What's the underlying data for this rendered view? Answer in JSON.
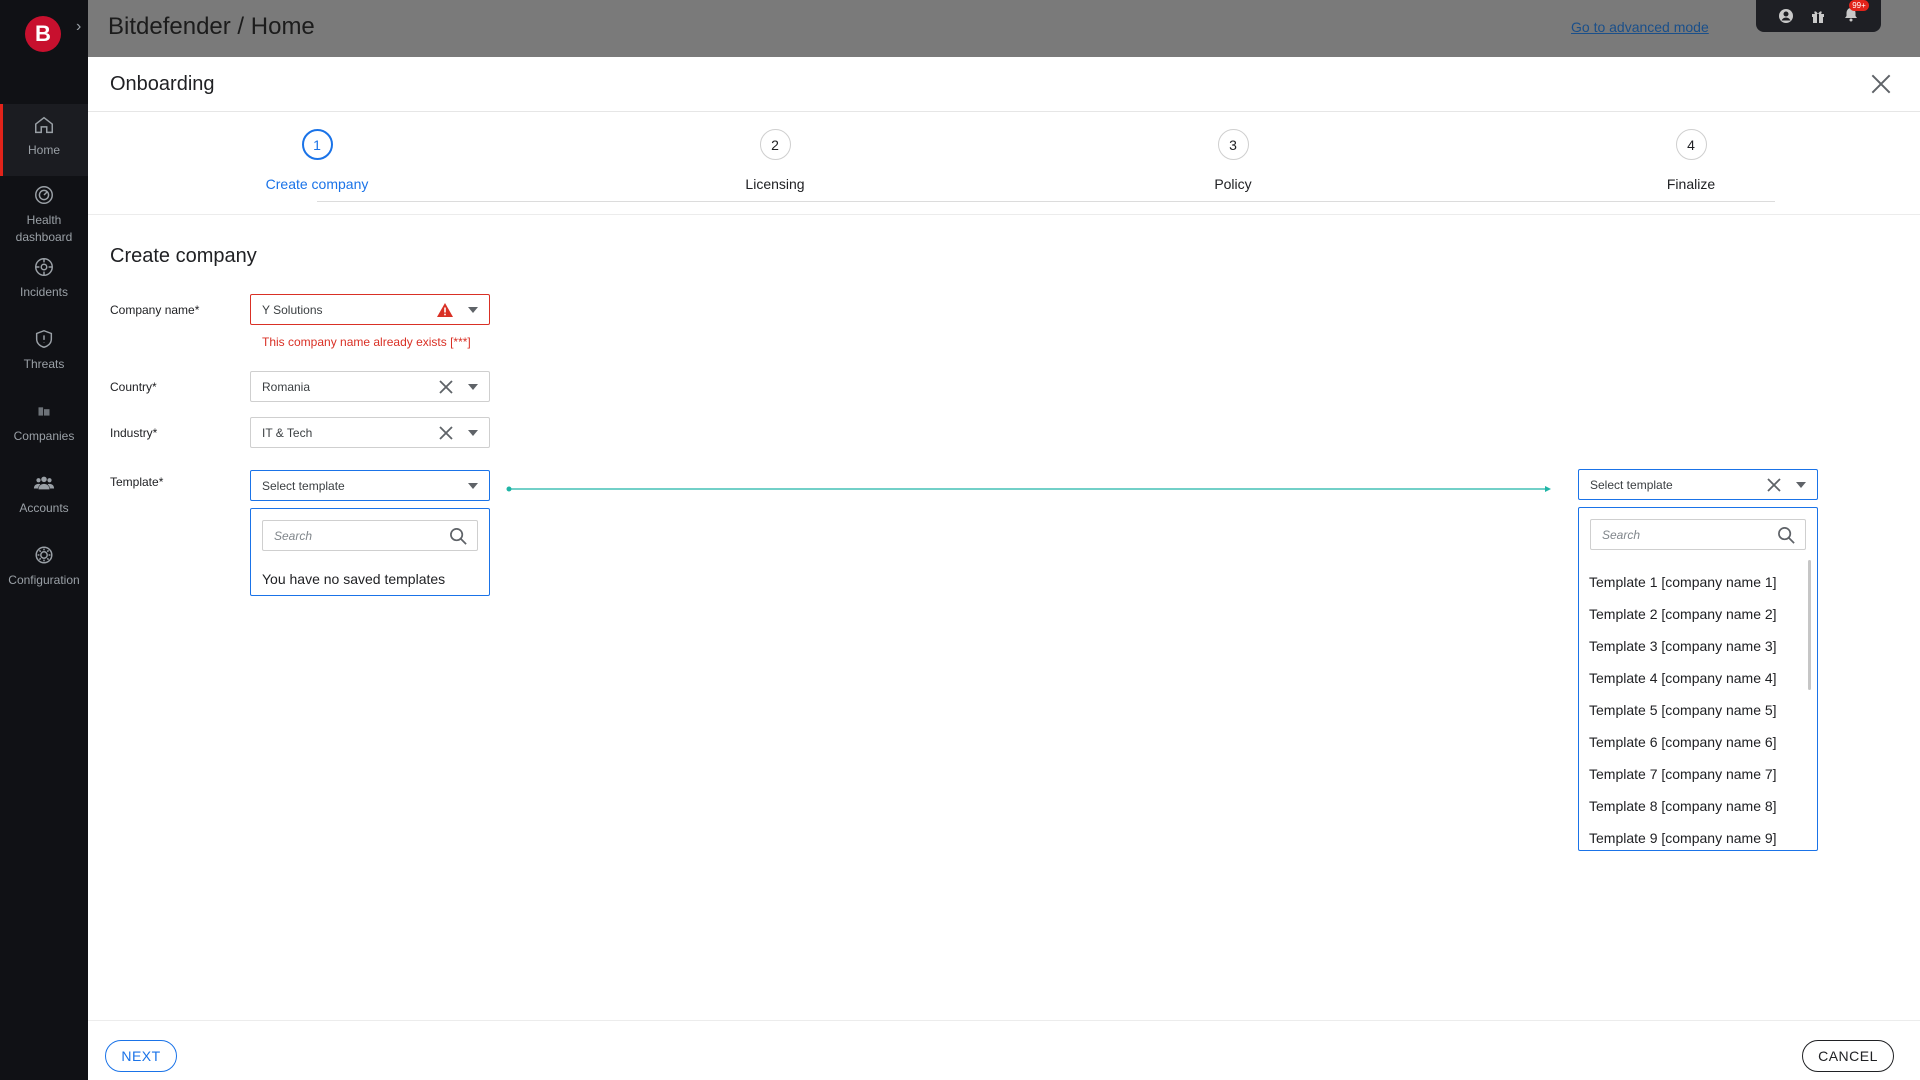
{
  "sidebar": {
    "logo": "B",
    "items": [
      {
        "label": "Home",
        "icon": "home-icon"
      },
      {
        "label": "Health dashboard",
        "icon": "health-icon"
      },
      {
        "label": "Incidents",
        "icon": "incidents-icon"
      },
      {
        "label": "Threats",
        "icon": "shield-icon"
      },
      {
        "label": "Companies",
        "icon": "companies-icon"
      },
      {
        "label": "Accounts",
        "icon": "accounts-icon"
      },
      {
        "label": "Configuration",
        "icon": "gear-icon"
      }
    ]
  },
  "topbar": {
    "breadcrumb": "Bitdefender / Home",
    "advanced_link": "Go to advanced mode",
    "notification_badge": "99+"
  },
  "modal": {
    "title": "Onboarding",
    "steps": [
      {
        "number": "1",
        "label": "Create company"
      },
      {
        "number": "2",
        "label": "Licensing"
      },
      {
        "number": "3",
        "label": "Policy"
      },
      {
        "number": "4",
        "label": "Finalize"
      }
    ],
    "section_title": "Create company"
  },
  "form": {
    "company_name": {
      "label": "Company name*",
      "value": "Y Solutions",
      "error": "This company name already exists [***]"
    },
    "country": {
      "label": "Country*",
      "value": "Romania"
    },
    "industry": {
      "label": "Industry*",
      "value": "IT & Tech"
    },
    "template": {
      "label": "Template*",
      "placeholder": "Select template",
      "search_placeholder": "Search",
      "empty_text": "You have no saved templates"
    }
  },
  "template_variant": {
    "placeholder": "Select template",
    "search_placeholder": "Search",
    "options": [
      "Template 1 [company name 1]",
      "Template 2 [company name 2]",
      "Template 3 [company name 3]",
      "Template 4 [company name 4]",
      "Template 5 [company name 5]",
      "Template 6 [company name 6]",
      "Template 7 [company name 7]",
      "Template 8 [company name 8]",
      "Template 9 [company name 9]"
    ]
  },
  "footer": {
    "next_label": "NEXT",
    "cancel_label": "CANCEL"
  },
  "colors": {
    "accent": "#1a73e8",
    "error": "#d93025",
    "brand": "#c8102e",
    "connector": "#1fb5a6"
  }
}
